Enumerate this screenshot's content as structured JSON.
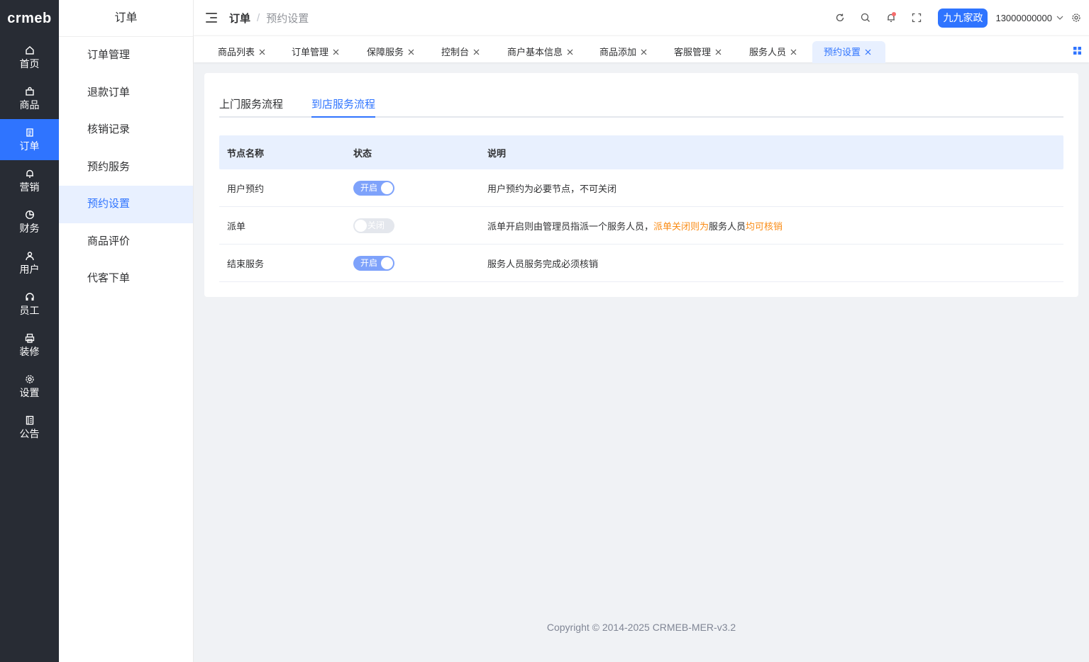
{
  "logo": "crmeb",
  "rail": [
    {
      "label": "首页",
      "icon": "home-icon"
    },
    {
      "label": "商品",
      "icon": "bag-icon"
    },
    {
      "label": "订单",
      "icon": "document-icon"
    },
    {
      "label": "营销",
      "icon": "bell-icon"
    },
    {
      "label": "财务",
      "icon": "pie-chart-icon"
    },
    {
      "label": "用户",
      "icon": "user-icon"
    },
    {
      "label": "员工",
      "icon": "headset-icon"
    },
    {
      "label": "装修",
      "icon": "printer-icon"
    },
    {
      "label": "设置",
      "icon": "gear-icon"
    },
    {
      "label": "公告",
      "icon": "notice-icon"
    }
  ],
  "submenu": {
    "title": "订单",
    "items": [
      "订单管理",
      "退款订单",
      "核销记录",
      "预约服务",
      "预约设置",
      "商品评价",
      "代客下单"
    ]
  },
  "header": {
    "breadcrumb_1": "订单",
    "breadcrumb_sep": "/",
    "breadcrumb_2": "预约设置",
    "merchant": "九九家政",
    "phone": "13000000000"
  },
  "tabs": [
    "商品列表",
    "订单管理",
    "保障服务",
    "控制台",
    "商户基本信息",
    "商品添加",
    "客服管理",
    "服务人员",
    "预约设置"
  ],
  "page": {
    "tabs": [
      "上门服务流程",
      "到店服务流程"
    ],
    "table": {
      "headers": [
        "节点名称",
        "状态",
        "说明"
      ],
      "rows": [
        {
          "name": "用户预约",
          "status": "开启",
          "on": true,
          "desc": "用户预约为必要节点，不可关闭"
        },
        {
          "name": "派单",
          "status": "关闭",
          "on": false,
          "desc_a": "派单开启则由管理员指派一个服务人员，",
          "desc_b": "派单关闭则为",
          "desc_c": "服务人员",
          "desc_d": "均可核销"
        },
        {
          "name": "结束服务",
          "status": "开启",
          "on": true,
          "desc": "服务人员服务完成必须核销"
        }
      ]
    }
  },
  "footer": "Copyright © 2014-2025 CRMEB-MER-v3.2",
  "colors": {
    "primary": "#2f74ff",
    "rail_bg": "#282c34",
    "highlight": "#fa8c16"
  }
}
